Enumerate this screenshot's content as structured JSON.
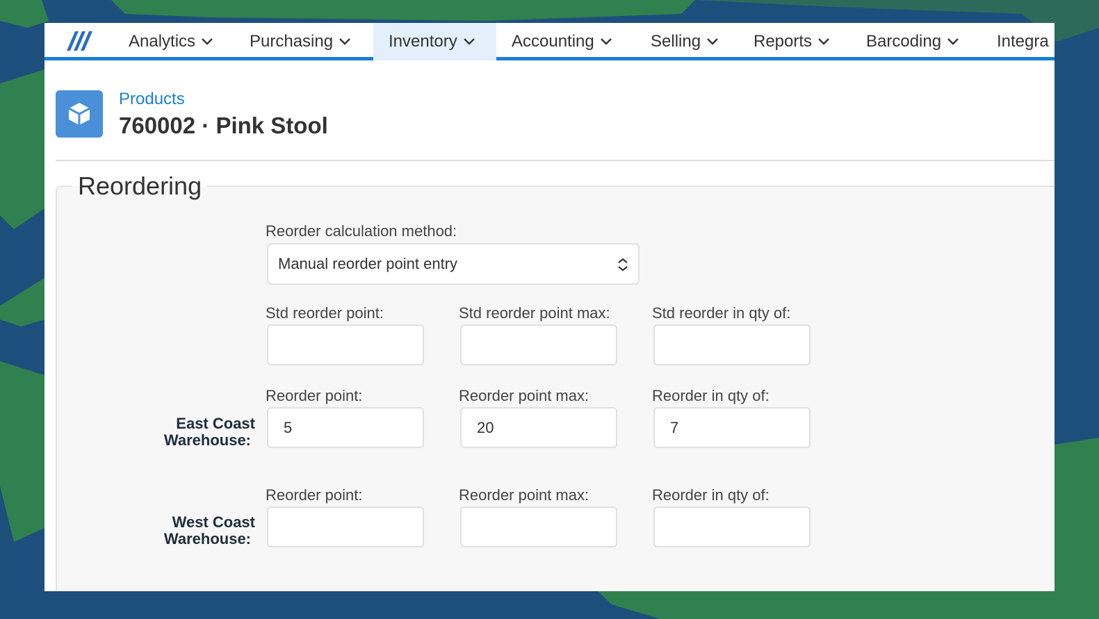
{
  "nav": {
    "items": [
      {
        "label": "Analytics"
      },
      {
        "label": "Purchasing"
      },
      {
        "label": "Inventory",
        "active": true
      },
      {
        "label": "Accounting"
      },
      {
        "label": "Selling"
      },
      {
        "label": "Reports"
      },
      {
        "label": "Barcoding"
      },
      {
        "label": "Integra"
      }
    ],
    "accent_color": "#1a7fd8"
  },
  "header": {
    "breadcrumb": "Products",
    "title": "760002 · Pink Stool",
    "icon": "box-icon"
  },
  "reordering": {
    "section_title": "Reordering",
    "method_label": "Reorder calculation method:",
    "method_value": "Manual reorder point entry",
    "std": {
      "point_label": "Std reorder point:",
      "max_label": "Std reorder point max:",
      "qty_label": "Std reorder in qty of:",
      "point_value": "",
      "max_value": "",
      "qty_value": ""
    },
    "warehouses": [
      {
        "name_line1": "East Coast",
        "name_line2": "Warehouse:",
        "point_label": "Reorder point:",
        "max_label": "Reorder point max:",
        "qty_label": "Reorder in qty of:",
        "point_value": "5",
        "max_value": "20",
        "qty_value": "7"
      },
      {
        "name_line1": "West Coast",
        "name_line2": "Warehouse:",
        "point_label": "Reorder point:",
        "max_label": "Reorder point max:",
        "qty_label": "Reorder in qty of:",
        "point_value": "",
        "max_value": "",
        "qty_value": ""
      }
    ]
  }
}
